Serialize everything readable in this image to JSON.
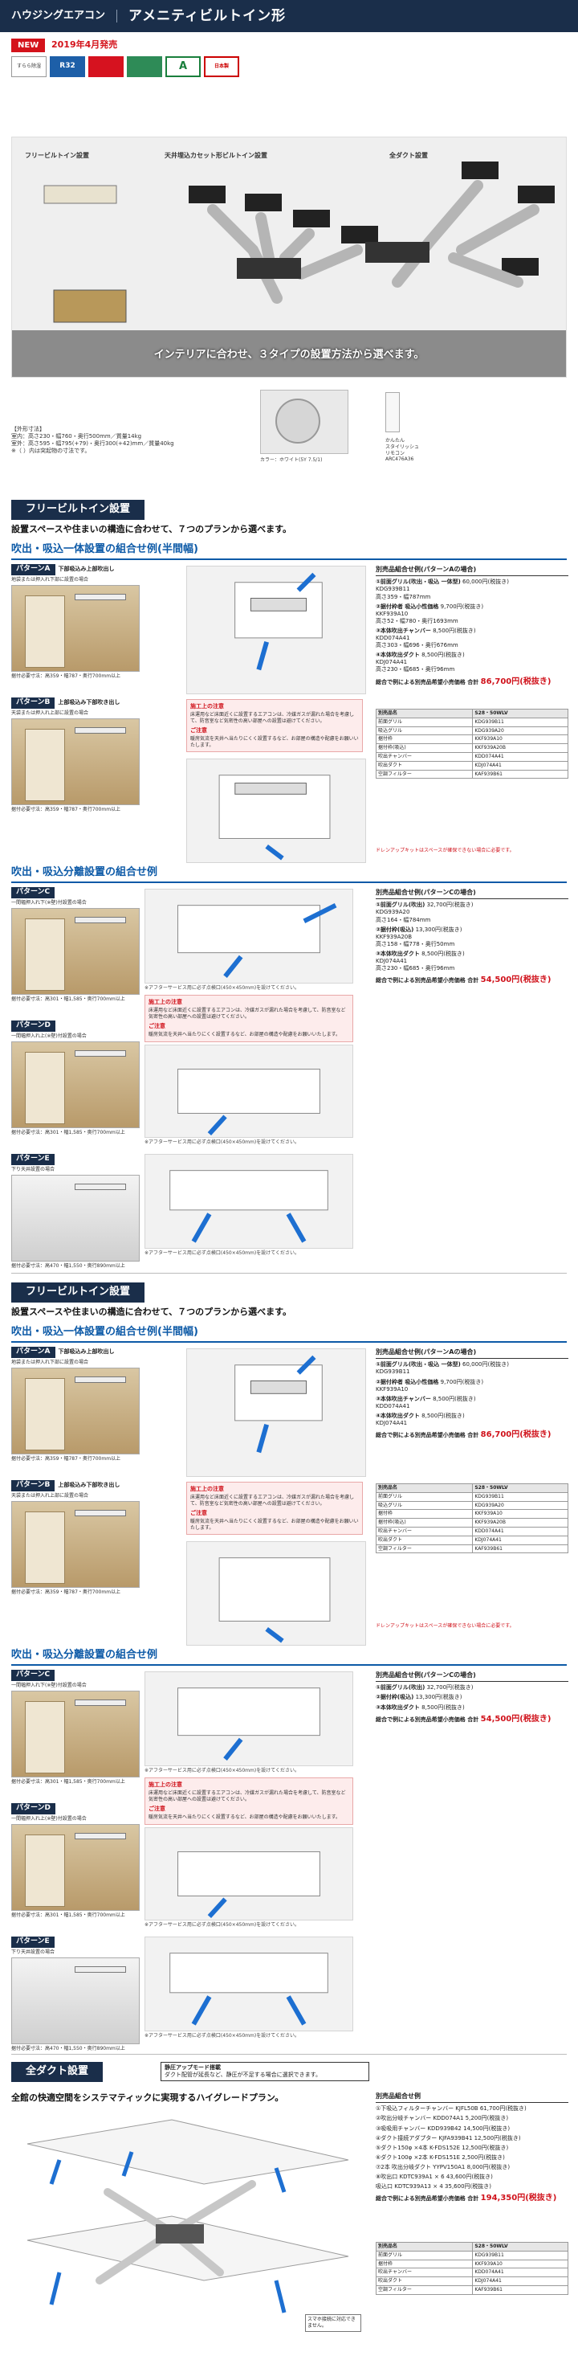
{
  "header": {
    "category": "ハウジングエアコン",
    "title": "アメニティビルトイン形"
  },
  "release": {
    "new_label": "NEW",
    "date_text": "2019年4月発売"
  },
  "badges": [
    "すらら除湿",
    "R32",
    "",
    "",
    "A",
    "日本製"
  ],
  "hero": {
    "label_flush": "フリービルトイン設置",
    "label_ceiling": "天井埋込カセット形ビルトイン設置",
    "label_duct": "全ダクト設置",
    "caption": "インテリアに合わせ、３タイプの設置方法から選べます。"
  },
  "specs": {
    "title": "【外形寸法】",
    "indoor": "室内：高さ230・幅760・奥行500mm／質量14kg",
    "outdoor": "室外：高さ595・幅795(+79)・奥行300(+42)mm／質量40kg",
    "note": "※（ ）内は突起物の寸法です。"
  },
  "outdoor_caption": "カラー：ホワイト(5Y 7.5/1)",
  "remote": {
    "l1": "かんたん",
    "l2": "スタイリッシュ",
    "l3": "リモコン",
    "l4": "ARC476A36"
  },
  "sections": [
    {
      "head": "フリービルトイン設置",
      "intro": "設置スペースや住まいの構造に合わせて、７つのプランから選べます。",
      "group1": "吹出・吸込一体設置の組合せ例(半間幅)",
      "group2": "吹出・吸込分離設置の組合せ例"
    },
    {
      "head": "フリービルトイン設置",
      "intro": "設置スペースや住まいの構造に合わせて、７つのプランから選べます。",
      "group1": "吹出・吸込一体設置の組合せ例(半間幅)",
      "group2": "吹出・吸込分離設置の組合せ例"
    }
  ],
  "patterns": {
    "A": {
      "tag": "パターンA",
      "desc": "下部吸込み上部吹出し",
      "sub": "地袋または押入れ下部に設置の場合",
      "foot": "据付必要寸法：高359・幅787・奥行700mm以上"
    },
    "B": {
      "tag": "パターンB",
      "desc": "上部吸込み下部吹き出し",
      "sub": "天袋または押入れ上部に設置の場合",
      "foot": "据付必要寸法：高359・幅787・奥行700mm以上"
    },
    "C": {
      "tag": "パターンC",
      "desc": "",
      "sub": "一間幅押入れ下(※壁)付設置の場合",
      "foot": "据付必要寸法：高301・幅1,585・奥行700mm以上"
    },
    "D": {
      "tag": "パターンD",
      "desc": "",
      "sub": "一間幅押入れ上(※壁)付設置の場合",
      "foot": "据付必要寸法：高301・幅1,585・奥行700mm以上"
    },
    "E": {
      "tag": "パターンE",
      "desc": "",
      "sub": "下り天井設置の場合",
      "foot": "据付必要寸法：高470・幅1,550・奥行890mm以上"
    }
  },
  "notes": {
    "caution_title": "施工上の注意",
    "caution_text": "床運用など床面近くに設置するエアコンは、冷媒ガスが漏れた場合を考慮して、防音室など気密性の高い部屋への設置は避けてください。",
    "request_title": "ご注意",
    "request_text": "暖房気流を天井へ当たりにくく設置するなど、お部屋の構造や配慮をお願いいたします。",
    "service_text": "※アフターサービス用に必ず点検口(450×450mm)を設けてください。"
  },
  "combo_ab": {
    "title": "別売品組合せ例(パターンAの場合)",
    "items": [
      {
        "n": "①前面グリル(吹出・吸込 一体型)",
        "model": "KDG939B11",
        "price": "60,000円(税抜き)",
        "size": "高さ359・幅787mm"
      },
      {
        "n": "②据付枠者 吸込小性価格",
        "model": "KKF939A10",
        "price": "9,700円(税抜き)",
        "size": "高さ52・幅780・奥行1693mm"
      },
      {
        "n": "③本体吹出チャンバー",
        "model": "KDD074A41",
        "price": "8,500円(税抜き)",
        "size": "高さ303・幅696・奥行676mm"
      },
      {
        "n": "④本体吹出ダクト",
        "model": "KDJ074A41",
        "price": "8,500円(税抜き)",
        "size": "高さ230・幅685・奥行96mm"
      }
    ],
    "total_label": "総合で例による別売品希望小売価格 合計",
    "total_price": "86,700円(税抜き)"
  },
  "combo_c": {
    "title": "別売品組合せ例(パターンCの場合)",
    "items": [
      {
        "n": "①前面グリル(吹出)",
        "model": "KDG939A20",
        "price": "32,700円(税抜き)",
        "size": "高さ164・幅784mm"
      },
      {
        "n": "②据付枠(吸込)",
        "model": "KKF939A20B",
        "price": "13,300円(税抜き)",
        "size": "高さ158・幅778・奥行50mm"
      },
      {
        "n": "③本体吹出ダクト",
        "model": "KDJ074A41",
        "price": "8,500円(税抜き)",
        "size": "高さ230・幅685・奥行96mm"
      }
    ],
    "total_label": "総合で例による別売品希望小売価格 合計",
    "total_price": "54,500円(税抜き)"
  },
  "ptable": {
    "headers": [
      "別売品名",
      "S28・50WLV"
    ],
    "rows": [
      [
        "前面グリル",
        "KDG939B11"
      ],
      [
        "吸込グリル",
        "KDG939A20"
      ],
      [
        "据付枠",
        "KKF939A10"
      ],
      [
        "据付枠(吸込)",
        "KKF939A20B"
      ],
      [
        "吹出チャンバー",
        "KDD074A41"
      ],
      [
        "吹出ダクト",
        "KDJ074A41"
      ],
      [
        "空調フィルター",
        "KAF939B61"
      ]
    ]
  },
  "footnote": "ドレンアップキットはスペースが確保できない場合に必要です。",
  "duct": {
    "head": "全ダクト設置",
    "badge": "静圧アップモード搭載",
    "badge_sub": "ダクト配管が延長など、静圧が不足する場合に選択できます。",
    "intro": "全館の快適空間をシステマティックに実現するハイグレードプラン。",
    "combo_title": "別売品組合せ例",
    "items": [
      {
        "n": "①下吸込フィルターチャンバー KJFL50B",
        "price": "61,700円(税抜き)"
      },
      {
        "n": "②吹出分岐チャンバー KDD074A1",
        "price": "5,200円(税抜き)"
      },
      {
        "n": "③吸吸用チャンバー KDD939B42",
        "price": "14,500円(税抜き)"
      },
      {
        "n": "④ダクト接続アダプター KJFA939B41",
        "price": "12,500円(税抜き)"
      },
      {
        "n": "⑤ダクト150φ ×4本 K-FDS152E",
        "price": "12,500円(税抜き)"
      },
      {
        "n": "⑥ダクト100φ ×2本 K-FDS151E",
        "price": "2,500円(税抜き)"
      },
      {
        "n": "⑦2本 吹出分岐ダクト YYPV150A1",
        "price": "8,000円(税抜き)"
      },
      {
        "n": "⑧吹出口 KDTC939A1 × 6",
        "price": "43,600円(税抜き)"
      },
      {
        "n": "吸込口 KDTC939A13 × 4",
        "price": "35,600円(税抜き)"
      }
    ],
    "total_label": "総合で例による別売品希望小売価格 合計",
    "total_price": "194,350円(税抜き)",
    "smart_label": "スマホ接続に対応できません。"
  }
}
